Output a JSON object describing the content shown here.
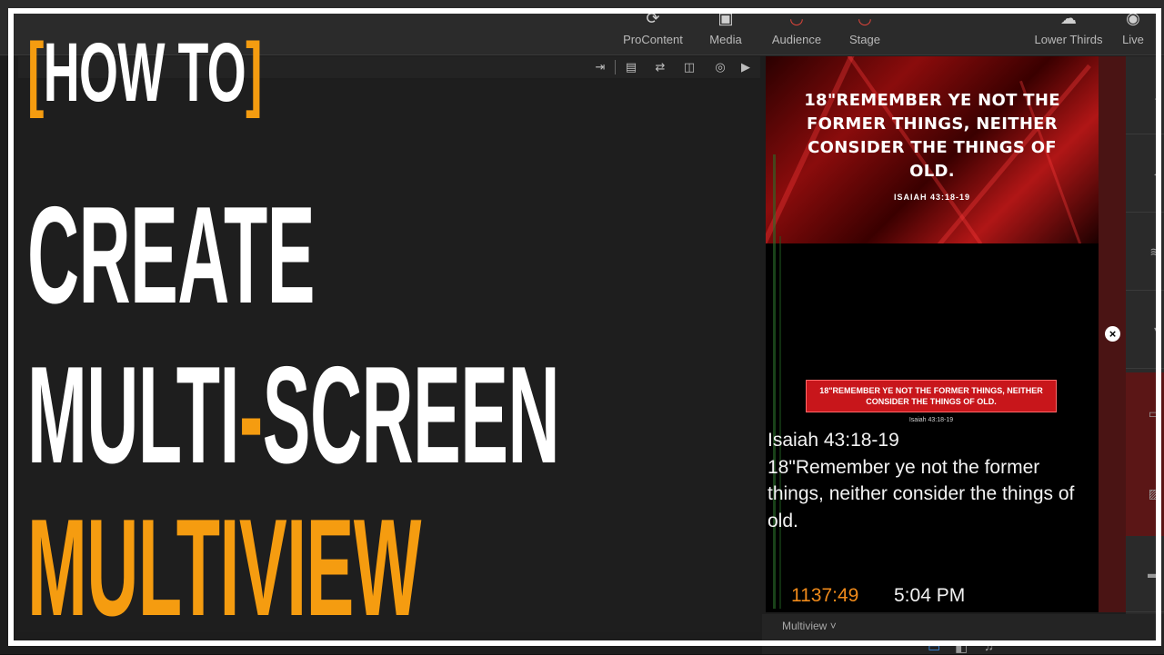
{
  "nav": {
    "items": [
      {
        "label": "ProContent",
        "icon": "procontent-icon"
      },
      {
        "label": "Media",
        "icon": "media-icon"
      },
      {
        "label": "Audience",
        "icon": "audience-icon"
      },
      {
        "label": "Stage",
        "icon": "stage-icon"
      },
      {
        "label": "Lower Thirds",
        "icon": "lower-thirds-icon"
      },
      {
        "label": "Live",
        "icon": "live-icon"
      }
    ]
  },
  "preview": {
    "slide_verse": "18\"REMEMBER YE NOT THE FORMER THINGS, NEITHER CONSIDER THE THINGS OF OLD.",
    "slide_ref": "ISAIAH 43:18-19",
    "lower_third_text": "18\"REMEMBER YE NOT THE FORMER THINGS, NEITHER CONSIDER THE THINGS OF OLD.",
    "lower_third_ref": "Isaiah 43:18-19",
    "stage_ref": "Isaiah 43:18-19",
    "stage_verse": "18\"Remember ye not the former things, neither consider the things of old.",
    "timer": "1137:49",
    "clock": "5:04 PM"
  },
  "footer": {
    "view_label": "Multiview",
    "dropdown_glyph": "˅"
  },
  "overlay": {
    "howto_open": "[",
    "howto_text": "HOW TO",
    "howto_close": "]",
    "line1": "CREATE",
    "line2_a": "MULTI",
    "line2_dash": "-",
    "line2_b": "SCREEN",
    "line3": "MULTIVIEW"
  },
  "colors": {
    "accent": "#f59c10",
    "timer": "#f08a1a",
    "lower_third_bg": "#c8161b"
  }
}
